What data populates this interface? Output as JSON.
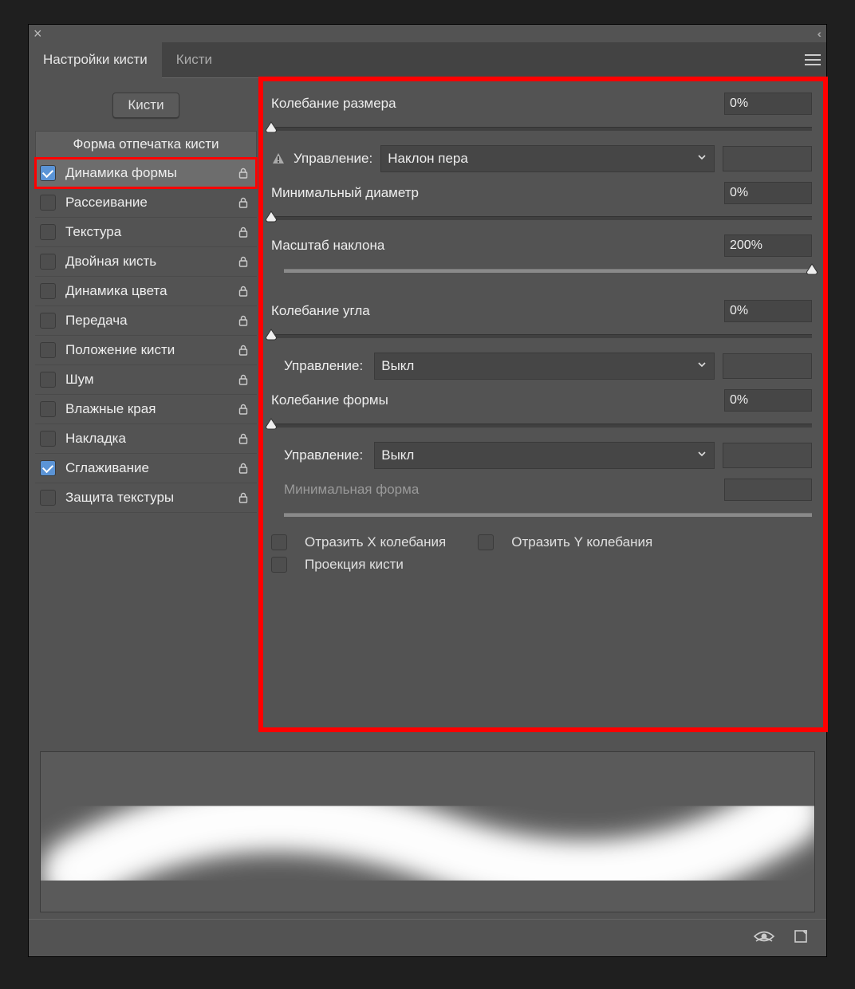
{
  "tabs": {
    "active": "Настройки кисти",
    "inactive": "Кисти"
  },
  "brushes_button": "Кисти",
  "section_head": "Форма отпечатка кисти",
  "sidebar": [
    {
      "label": "Динамика формы",
      "checked": true,
      "lock": true,
      "highlighted": true
    },
    {
      "label": "Рассеивание",
      "checked": false,
      "lock": true
    },
    {
      "label": "Текстура",
      "checked": false,
      "lock": true
    },
    {
      "label": "Двойная кисть",
      "checked": false,
      "lock": true
    },
    {
      "label": "Динамика цвета",
      "checked": false,
      "lock": true
    },
    {
      "label": "Передача",
      "checked": false,
      "lock": true
    },
    {
      "label": "Положение кисти",
      "checked": false,
      "lock": true
    },
    {
      "label": "Шум",
      "checked": false,
      "lock": true
    },
    {
      "label": "Влажные края",
      "checked": false,
      "lock": true
    },
    {
      "label": "Накладка",
      "checked": false,
      "lock": true
    },
    {
      "label": "Сглаживание",
      "checked": true,
      "lock": true
    },
    {
      "label": "Защита текстуры",
      "checked": false,
      "lock": true
    }
  ],
  "controls": {
    "size_jitter": {
      "label": "Колебание размера",
      "value": "0%",
      "slider": 0
    },
    "size_control": {
      "label": "Управление:",
      "value": "Наклон пера",
      "warn": true
    },
    "min_diam": {
      "label": "Минимальный диаметр",
      "value": "0%",
      "slider": 0
    },
    "tilt_scale": {
      "label": "Масштаб наклона",
      "value": "200%",
      "slider": 100
    },
    "angle_jitter": {
      "label": "Колебание угла",
      "value": "0%",
      "slider": 0
    },
    "angle_control": {
      "label": "Управление:",
      "value": "Выкл"
    },
    "round_jitter": {
      "label": "Колебание формы",
      "value": "0%",
      "slider": 0
    },
    "round_control": {
      "label": "Управление:",
      "value": "Выкл"
    },
    "min_round": {
      "label": "Минимальная форма",
      "value": ""
    },
    "flipx": "Отразить X колебания",
    "flipy": "Отразить Y колебания",
    "proj": "Проекция кисти"
  }
}
